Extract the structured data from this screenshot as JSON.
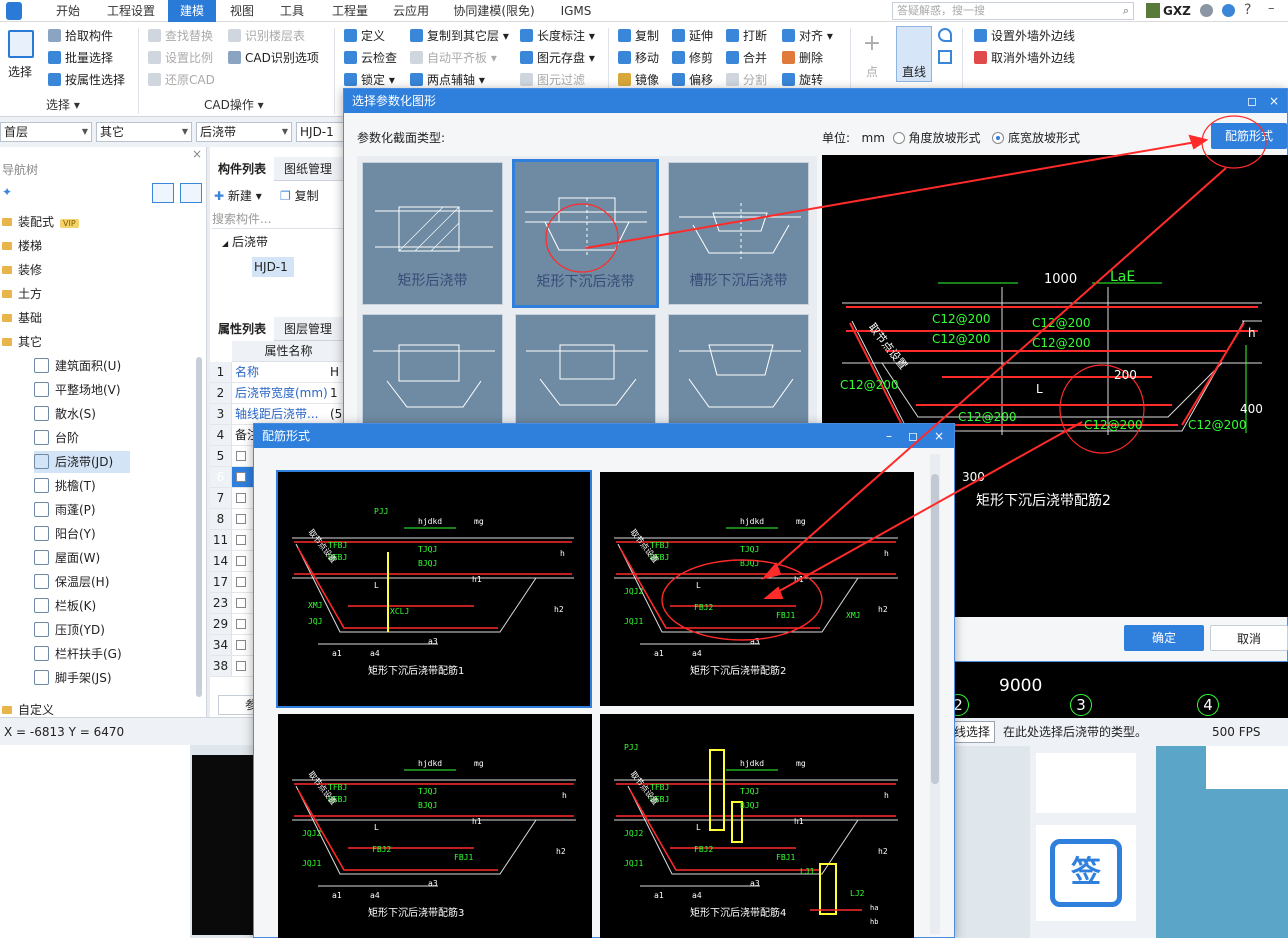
{
  "menu": {
    "items": [
      "开始",
      "工程设置",
      "建模",
      "视图",
      "工具",
      "工程量",
      "云应用",
      "协同建模(限免)",
      "IGMS"
    ],
    "active_index": 2,
    "search_placeholder": "答疑解惑，搜一搜",
    "user": "GXZ"
  },
  "ribbon": {
    "select_label": "选择",
    "pick": "拾取构件",
    "batch": "批量选择",
    "byattr": "按属性选择",
    "group_select": "选择 ▾",
    "find_replace": "查找替换",
    "set_scale": "设置比例",
    "restore_cad": "还原CAD",
    "recog_floor": "识别楼层表",
    "cad_options": "CAD识别选项",
    "group_cad": "CAD操作 ▾",
    "define": "定义",
    "cloud_check": "云检查",
    "lock": "锁定 ▾",
    "copy_to_floor": "复制到其它层 ▾",
    "auto_align": "自动平齐板 ▾",
    "two_point_axis": "两点辅轴 ▾",
    "length_dim": "长度标注 ▾",
    "elem_save": "图元存盘 ▾",
    "elem_filter": "图元过滤",
    "copy": "复制",
    "move": "移动",
    "mirror": "镜像",
    "extend": "延伸",
    "trim": "修剪",
    "offset": "偏移",
    "break": "打断",
    "merge": "合并",
    "split": "分割",
    "align": "对齐 ▾",
    "delete": "删除",
    "rotate": "旋转",
    "point": "点",
    "line": "直线",
    "set_outer_edge": "设置外墙外边线",
    "cancel_outer_edge": "取消外墙外边线"
  },
  "toolrow": {
    "floor": "首层",
    "category": "其它",
    "type": "后浇带",
    "name": "HJD-1"
  },
  "navtree": {
    "title": "导航树",
    "folders_top": [
      {
        "label": "装配式",
        "badge": "VIP"
      },
      {
        "label": "楼梯"
      },
      {
        "label": "装修"
      },
      {
        "label": "土方"
      },
      {
        "label": "基础"
      },
      {
        "label": "其它"
      }
    ],
    "children": [
      "建筑面积(U)",
      "平整场地(V)",
      "散水(S)",
      "台阶",
      "后浇带(JD)",
      "挑檐(T)",
      "雨蓬(P)",
      "阳台(Y)",
      "屋面(W)",
      "保温层(H)",
      "栏板(K)",
      "压顶(YD)",
      "栏杆扶手(G)",
      "脚手架(JS)"
    ],
    "selected_child_index": 4,
    "folder_bottom": "自定义"
  },
  "complist": {
    "tab1": "构件列表",
    "tab2": "图纸管理",
    "new": "新建 ▾",
    "copy": "复制",
    "search_placeholder": "搜索构件...",
    "group": "后浇带",
    "item": "HJD-1"
  },
  "props": {
    "tab1": "属性列表",
    "tab2": "图层管理",
    "header": "属性名称",
    "rows": [
      {
        "n": "1",
        "name": "名称",
        "v": "H"
      },
      {
        "n": "2",
        "name": "后浇带宽度(mm)",
        "v": "1"
      },
      {
        "n": "3",
        "name": "轴线距后浇带...",
        "v": "(5"
      },
      {
        "n": "4",
        "name": "备注",
        "v": ""
      },
      {
        "n": "5",
        "name": "",
        "v": ""
      },
      {
        "n": "6",
        "name": "",
        "v": ""
      },
      {
        "n": "7",
        "name": "",
        "v": ""
      },
      {
        "n": "8",
        "name": "",
        "v": ""
      },
      {
        "n": "11",
        "name": "",
        "v": ""
      },
      {
        "n": "14",
        "name": "",
        "v": ""
      },
      {
        "n": "17",
        "name": "",
        "v": ""
      },
      {
        "n": "23",
        "name": "",
        "v": ""
      },
      {
        "n": "29",
        "name": "",
        "v": ""
      },
      {
        "n": "34",
        "name": "",
        "v": ""
      },
      {
        "n": "38",
        "name": "",
        "v": ""
      }
    ],
    "bottom_tab": "参"
  },
  "status": {
    "coords": "X = -6813 Y = 6470",
    "hint": "在此处选择后浇带的类型。",
    "fps": "500 FPS",
    "button": "线选择"
  },
  "canvas": {
    "dim": "9000",
    "axes": [
      "2",
      "3",
      "4"
    ]
  },
  "dialog1": {
    "title": "选择参数化图形",
    "type_label": "参数化截面类型:",
    "unit_label": "单位:",
    "unit": "mm",
    "radio1": "角度放坡形式",
    "radio2": "底宽放坡形式",
    "rebar_button": "配筋形式",
    "tiles": [
      "矩形后浇带",
      "矩形下沉后浇带",
      "槽形下沉后浇带",
      "",
      "",
      ""
    ],
    "selected_tile": 1,
    "ok": "确定",
    "cancel": "取消",
    "preview": {
      "dim_1000": "1000",
      "lae": "LaE",
      "c12_top1": "C12@200",
      "c12_top2": "C12@200",
      "c12_mid1": "C12@200",
      "c12_mid2": "C12@200",
      "c12_left": "C12@200",
      "c12_bot1": "C12@200",
      "c12_bot2": "C12@200",
      "c12_right": "C12@200",
      "dim_200": "200",
      "dim_400": "400",
      "dim_300": "300",
      "dim_h": "h",
      "dim_l": "L",
      "slope_label": "取节点设置",
      "caption": "矩形下沉后浇带配筋2"
    }
  },
  "dialog2": {
    "title": "配筋形式",
    "cells": [
      {
        "caption": "矩形下沉后浇带配筋1"
      },
      {
        "caption": "矩形下沉后浇带配筋2"
      },
      {
        "caption": "矩形下沉后浇带配筋3"
      },
      {
        "caption": "矩形下沉后浇带配筋4"
      }
    ],
    "labels": {
      "hjdkd": "hjdkd",
      "mg": "mg",
      "pjj": "PJJ",
      "tfbj": "TFBJ",
      "bfbj": "BFBJ",
      "tjqj": "TJQJ",
      "bjqj": "BJQJ",
      "xmj": "XMJ",
      "jqj": "JQJ",
      "jqj1": "JQJ1",
      "jqj2": "JQJ2",
      "fbj1": "FBJ1",
      "fbj2": "FBJ2",
      "xcl": "XCLJ",
      "h": "h",
      "h1": "h1",
      "h2": "h2",
      "a1": "a1",
      "a3": "a3",
      "a4": "a4",
      "l": "L",
      "lj1": "LJ1",
      "lj2": "LJ2",
      "ha": "ha",
      "hb": "hb",
      "slope": "取节点设置"
    }
  },
  "colors": {
    "accent": "#2f7fdd",
    "annotation": "#ff2a2a",
    "cad_green": "#33ff33",
    "cad_white": "#ffffff"
  }
}
